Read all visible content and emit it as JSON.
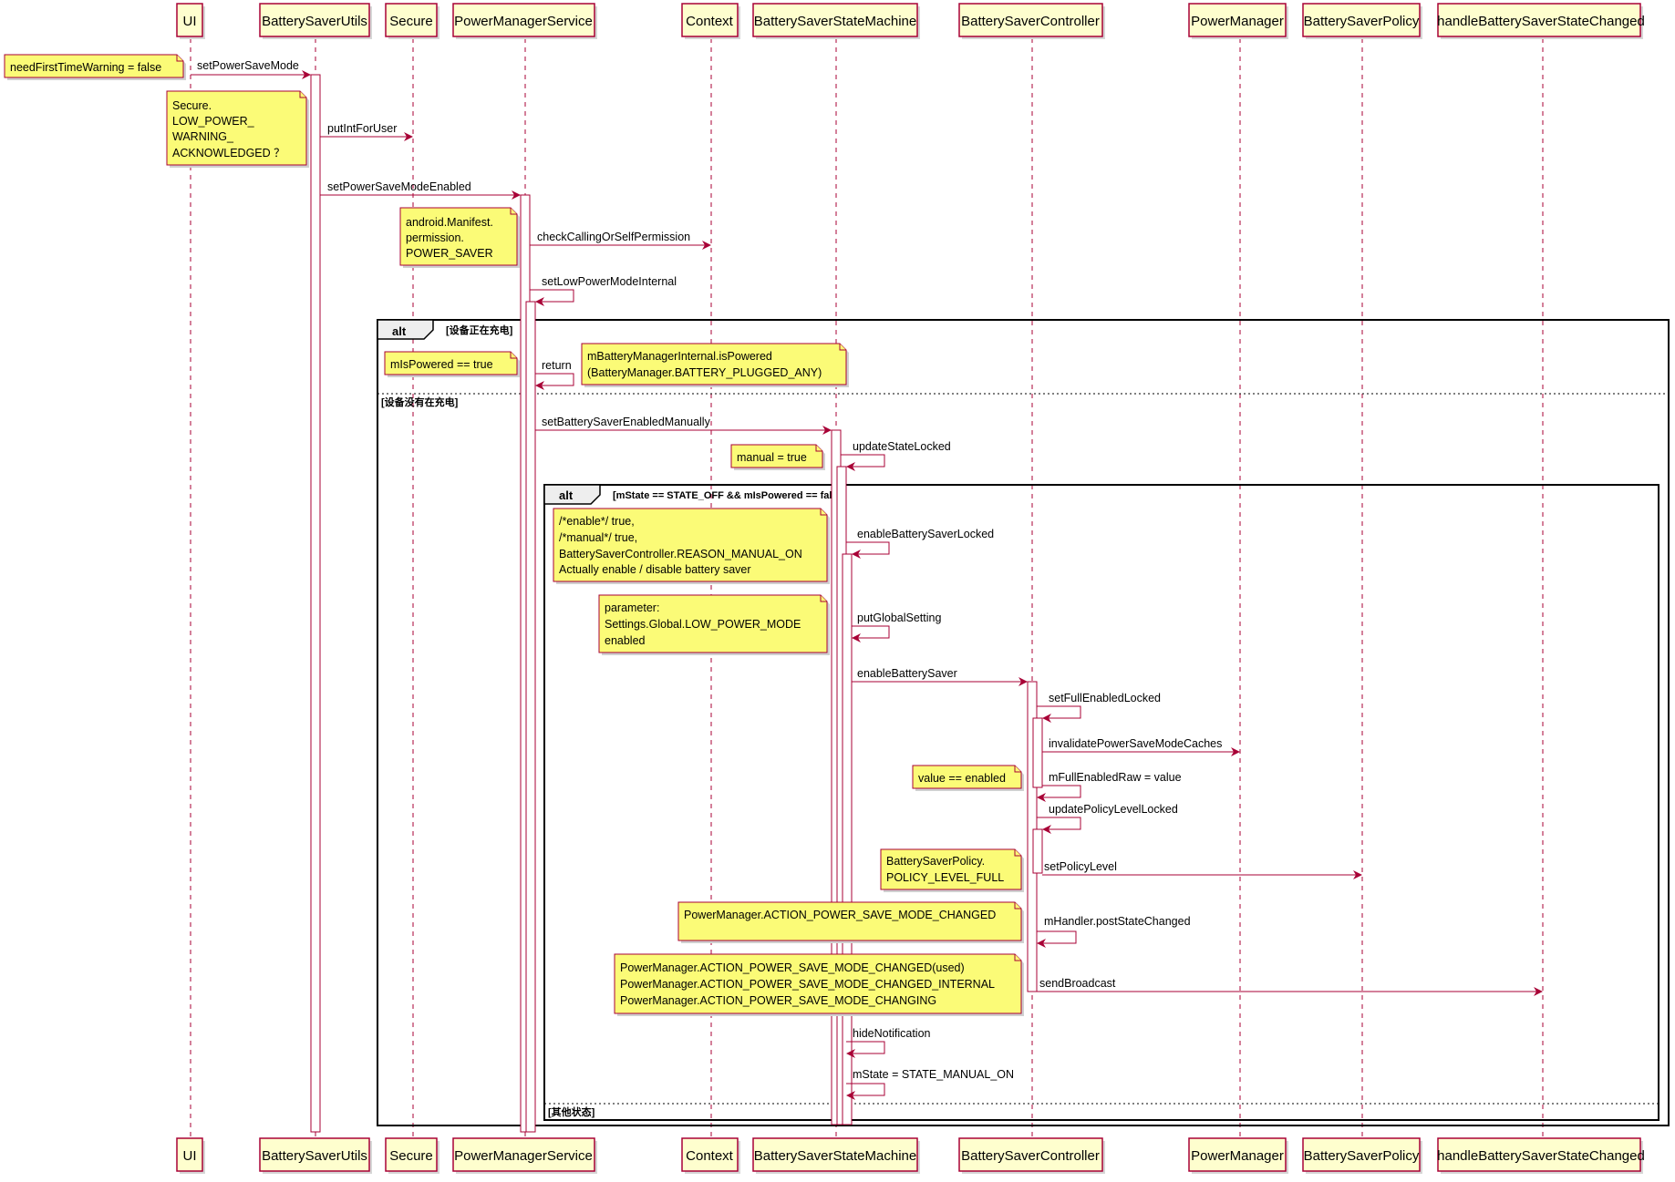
{
  "participants": [
    "UI",
    "BatterySaverUtils",
    "Secure",
    "PowerManagerService",
    "Context",
    "BatterySaverStateMachine",
    "BatterySaverController",
    "PowerManager",
    "BatterySaverPolicy",
    "handleBatterySaverStateChanged"
  ],
  "messages": {
    "set_power_save_mode": "setPowerSaveMode",
    "put_int_for_user": "putIntForUser",
    "set_power_save_mode_enabled": "setPowerSaveModeEnabled",
    "check_calling_or_self_permission": "checkCallingOrSelfPermission",
    "set_low_power_mode_internal": "setLowPowerModeInternal",
    "return": "return",
    "set_battery_saver_enabled_manually": "setBatterySaverEnabledManually",
    "update_state_locked": "updateStateLocked",
    "enable_battery_saver_locked": "enableBatterySaverLocked",
    "put_global_setting": "putGlobalSetting",
    "enable_battery_saver": "enableBatterySaver",
    "set_full_enabled_locked": "setFullEnabledLocked",
    "invalidate_power_save_mode_caches": "invalidatePowerSaveModeCaches",
    "m_full_enabled_raw": "mFullEnabledRaw = value",
    "update_policy_level_locked": "updatePolicyLevelLocked",
    "set_policy_level": "setPolicyLevel",
    "m_handler_post_state_changed": "mHandler.postStateChanged",
    "send_broadcast": "sendBroadcast",
    "hide_notification": "hideNotification",
    "m_state_manual_on": "mState = STATE_MANUAL_ON"
  },
  "notes": {
    "need_first_time_warning": [
      "needFirstTimeWarning = false"
    ],
    "secure_low_power": [
      "Secure.",
      "LOW_POWER_",
      "WARNING_",
      "ACKNOWLEDGED ？"
    ],
    "android_permission": [
      "android.Manifest.",
      "permission.",
      "POWER_SAVER"
    ],
    "m_is_powered_true": [
      "mIsPowered == true"
    ],
    "battery_manager_is_powered": [
      "mBatteryManagerInternal.isPowered",
      "(BatteryManager.BATTERY_PLUGGED_ANY)"
    ],
    "manual_true": [
      "manual = true"
    ],
    "enable_manual_params": [
      "/*enable*/ true,",
      "/*manual*/ true,",
      "BatterySaverController.REASON_MANUAL_ON",
      "Actually enable / disable battery saver"
    ],
    "parameter_low_power_mode": [
      "parameter:",
      "Settings.Global.LOW_POWER_MODE",
      "enabled"
    ],
    "value_enabled": [
      "value == enabled"
    ],
    "policy_level_full": [
      "BatterySaverPolicy.",
      "POLICY_LEVEL_FULL"
    ],
    "action_power_save_mode_changed": [
      "PowerManager.ACTION_POWER_SAVE_MODE_CHANGED"
    ],
    "broadcast_actions": [
      "PowerManager.ACTION_POWER_SAVE_MODE_CHANGED(used)",
      "PowerManager.ACTION_POWER_SAVE_MODE_CHANGED_INTERNAL",
      "PowerManager.ACTION_POWER_SAVE_MODE_CHANGING"
    ]
  },
  "fragments": {
    "outer_keyword": "alt",
    "outer_guard": "[设备正在充电]",
    "outer_else": "[设备没有在充电]",
    "inner_keyword": "alt",
    "inner_guard": "[mState == STATE_OFF && mIsPowered == false]",
    "inner_else": "[其他状态]"
  },
  "colors": {
    "participant_fill": "#FEFECE",
    "border": "#A80036",
    "note_fill": "#FBFB77"
  }
}
